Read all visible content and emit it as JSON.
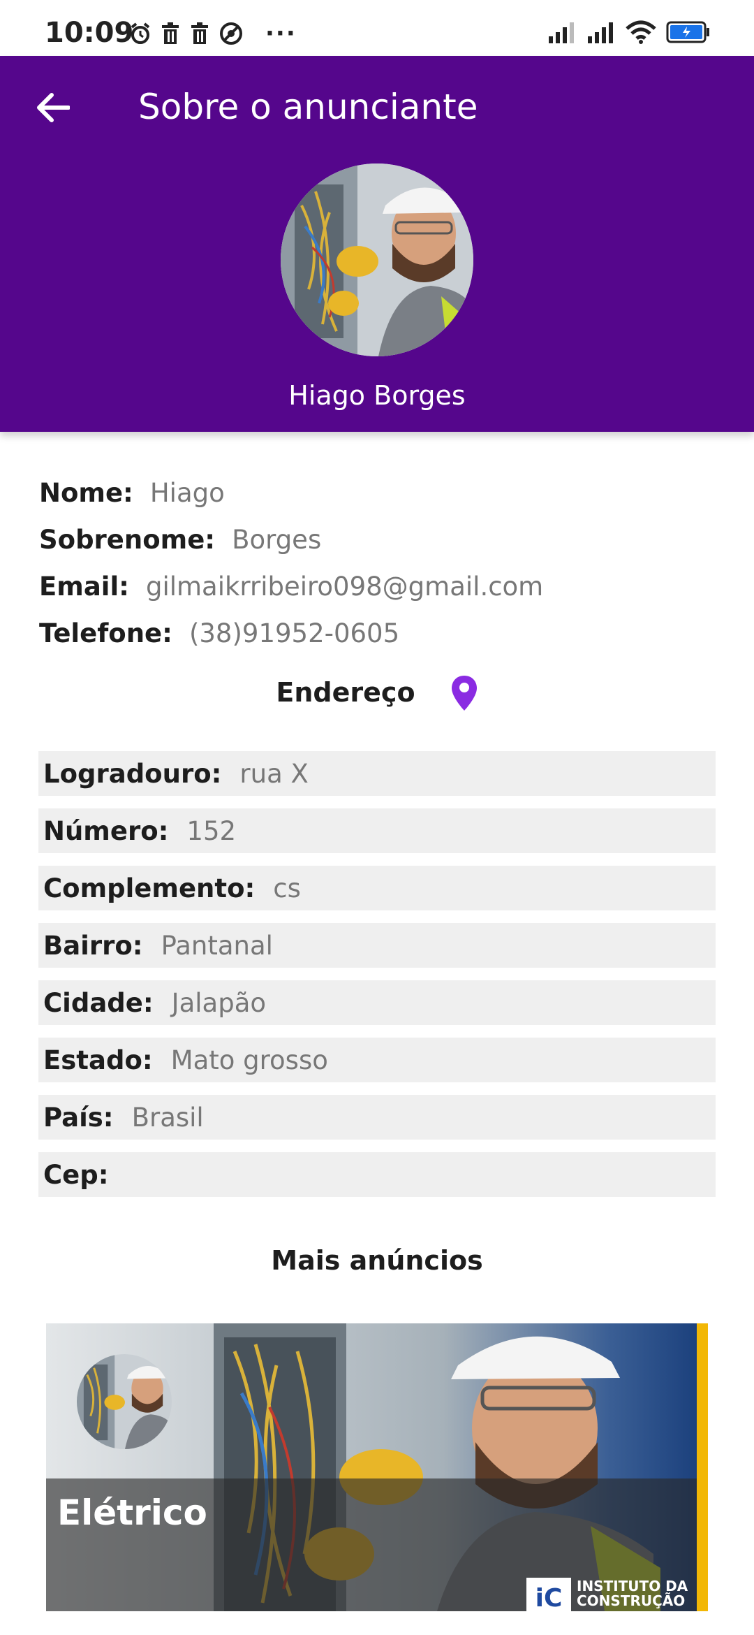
{
  "status_bar": {
    "time": "10:09",
    "left_icons": [
      "alarm-icon",
      "trash-icon",
      "trash-icon",
      "no-disturb-icon"
    ],
    "more": "···",
    "right_icons": [
      "signal-icon",
      "signal-icon",
      "wifi-icon",
      "battery-icon"
    ]
  },
  "header": {
    "title": "Sobre o anunciante",
    "back_icon": "arrow-left-icon",
    "background_color": "#55068c",
    "name": "Hiago Borges"
  },
  "info": {
    "nome_label": "Nome:",
    "nome_value": "Hiago",
    "sobrenome_label": "Sobrenome:",
    "sobrenome_value": "Borges",
    "email_label": "Email:",
    "email_value": "gilmaikrribeiro098@gmail.com",
    "telefone_label": "Telefone:",
    "telefone_value": "(38)91952-0605"
  },
  "address": {
    "title": "Endereço",
    "pin_color": "#8a2be2",
    "rows": [
      {
        "label": "Logradouro:",
        "value": "rua X"
      },
      {
        "label": "Número:",
        "value": "152"
      },
      {
        "label": "Complemento:",
        "value": "cs"
      },
      {
        "label": "Bairro:",
        "value": "Pantanal"
      },
      {
        "label": "Cidade:",
        "value": "Jalapão"
      },
      {
        "label": "Estado:",
        "value": "Mato grosso"
      },
      {
        "label": "País:",
        "value": "Brasil"
      },
      {
        "label": "Cep:",
        "value": ""
      }
    ]
  },
  "more_ads": {
    "title": "Mais anúncios",
    "cards": [
      {
        "title": "Elétrico",
        "brand_mark": "iC",
        "brand_line1": "INSTITUTO DA",
        "brand_line2": "CONSTRUÇÃO"
      }
    ]
  }
}
